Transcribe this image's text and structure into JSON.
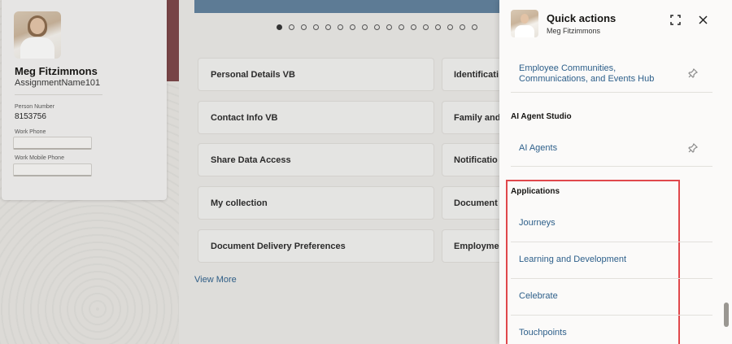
{
  "person": {
    "name": "Meg Fitzimmons",
    "assignment_name": "AssignmentName101",
    "person_number_label": "Person Number",
    "person_number": "8153756",
    "work_phone_label": "Work Phone",
    "work_mobile_label": "Work Mobile Phone"
  },
  "carousel": {
    "dot_count": 17,
    "active_index": 0
  },
  "tiles": {
    "left": [
      "Personal Details VB",
      "Contact Info VB",
      "Share Data Access",
      "My collection",
      "Document Delivery Preferences"
    ],
    "right": [
      "Identificati",
      "Family and",
      "Notificatio",
      "Document R",
      "Employmen"
    ]
  },
  "view_more": "View More",
  "quick_actions": {
    "title": "Quick actions",
    "subtitle": "Meg Fitzimmons",
    "employee_hub_link": "Employee Communities, Communications, and Events Hub",
    "ai_section": "AI Agent Studio",
    "ai_agents_link": "AI Agents",
    "applications_section": "Applications",
    "applications": [
      "Journeys",
      "Learning and Development",
      "Celebrate",
      "Touchpoints"
    ]
  },
  "colors": {
    "link": "#2d5f8a",
    "highlight": "#e0484c"
  },
  "icons": {
    "expand": "expand-icon",
    "close": "close-icon",
    "pin": "pin-icon"
  }
}
